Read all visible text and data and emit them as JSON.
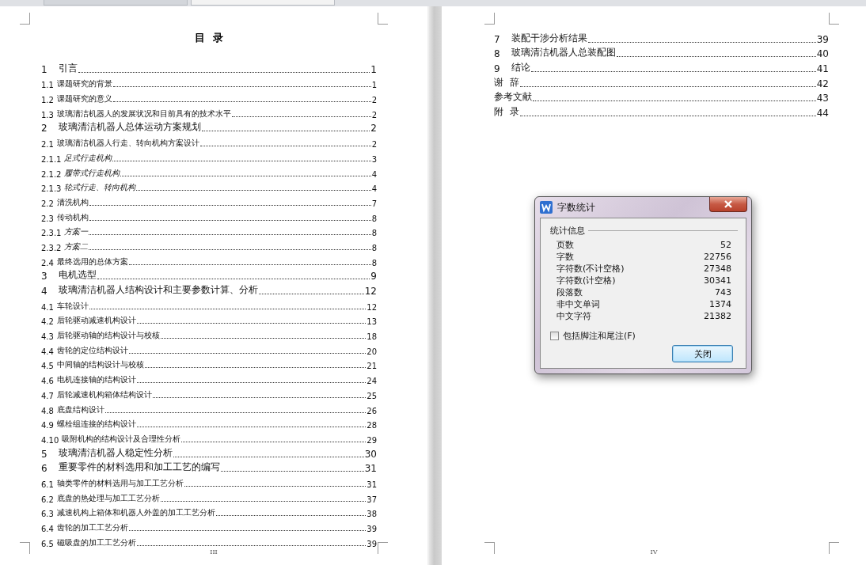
{
  "left_page": {
    "title": "目  录",
    "footer": "III",
    "entries": [
      {
        "kind": "chapter",
        "number": "1",
        "title": "引言",
        "page": "1"
      },
      {
        "kind": "section",
        "number": "1.1",
        "title": "课题研究的背景",
        "page": "1"
      },
      {
        "kind": "section",
        "number": "1.2",
        "title": "课题研究的意义",
        "page": "2"
      },
      {
        "kind": "section",
        "number": "1.3",
        "title": "玻璃清洁机器人的发展状况和目前具有的技术水平",
        "page": "2"
      },
      {
        "kind": "chapter",
        "number": "2",
        "title": "玻璃清洁机器人总体运动方案规划",
        "page": "2"
      },
      {
        "kind": "section",
        "number": "2.1",
        "title": "玻璃清洁机器人行走、转向机构方案设计",
        "page": "2"
      },
      {
        "kind": "subsection",
        "number": "2.1.1",
        "title": "足式行走机构",
        "page": "3"
      },
      {
        "kind": "subsection",
        "number": "2.1.2",
        "title": "履带式行走机构",
        "page": "4"
      },
      {
        "kind": "subsection",
        "number": "2.1.3",
        "title": "轮式行走、转向机构",
        "page": "4"
      },
      {
        "kind": "section",
        "number": "2.2",
        "title": "清洗机构",
        "page": "7"
      },
      {
        "kind": "section",
        "number": "2.3",
        "title": "传动机构",
        "page": "8"
      },
      {
        "kind": "subsection",
        "number": "2.3.1",
        "title": "方案一",
        "page": "8"
      },
      {
        "kind": "subsection",
        "number": "2.3.2",
        "title": "方案二",
        "page": "8"
      },
      {
        "kind": "section",
        "number": "2.4",
        "title": "最终选用的总体方案",
        "page": "8"
      },
      {
        "kind": "chapter",
        "number": "3",
        "title": "电机选型",
        "page": "9"
      },
      {
        "kind": "chapter",
        "number": "4",
        "title": "玻璃清洁机器人结构设计和主要参数计算、分析",
        "page": "12"
      },
      {
        "kind": "section",
        "number": "4.1",
        "title": "车轮设计",
        "page": "12"
      },
      {
        "kind": "section",
        "number": "4.2",
        "title": "后轮驱动减速机构设计",
        "page": "13"
      },
      {
        "kind": "section",
        "number": "4.3",
        "title": "后轮驱动轴的结构设计与校核",
        "page": "18"
      },
      {
        "kind": "section",
        "number": "4.4",
        "title": "齿轮的定位结构设计",
        "page": "20"
      },
      {
        "kind": "section",
        "number": "4.5",
        "title": "中间轴的结构设计与校核",
        "page": "21"
      },
      {
        "kind": "section",
        "number": "4.6",
        "title": "电机连接轴的结构设计",
        "page": "24"
      },
      {
        "kind": "section",
        "number": "4.7",
        "title": "后轮减速机构箱体结构设计",
        "page": "25"
      },
      {
        "kind": "section",
        "number": "4.8",
        "title": "底盘结构设计",
        "page": "26"
      },
      {
        "kind": "section",
        "number": "4.9",
        "title": "螺栓组连接的结构设计",
        "page": "28"
      },
      {
        "kind": "section",
        "number": "4.10",
        "title": "吸附机构的结构设计及合理性分析",
        "page": "29"
      },
      {
        "kind": "chapter",
        "number": "5",
        "title": "玻璃清洁机器人稳定性分析",
        "page": "30"
      },
      {
        "kind": "chapter",
        "number": "6",
        "title": "重要零件的材料选用和加工工艺的编写",
        "page": "31"
      },
      {
        "kind": "section",
        "number": "6.1",
        "title": "轴类零件的材料选用与加工工艺分析",
        "page": "31"
      },
      {
        "kind": "section",
        "number": "6.2",
        "title": "底盘的热处理与加工工艺分析",
        "page": "37"
      },
      {
        "kind": "section",
        "number": "6.3",
        "title": "减速机构上箱体和机器人外盖的加工工艺分析",
        "page": "38"
      },
      {
        "kind": "section",
        "number": "6.4",
        "title": "齿轮的加工工艺分析",
        "page": "39"
      },
      {
        "kind": "section",
        "number": "6.5",
        "title": "磁吸盘的加工工艺分析",
        "page": "39"
      }
    ]
  },
  "right_page": {
    "footer": "IV",
    "entries": [
      {
        "kind": "chapter",
        "number": "7",
        "title": "装配干涉分析结果",
        "page": "39"
      },
      {
        "kind": "chapter",
        "number": "8",
        "title": "玻璃清洁机器人总装配图",
        "page": "40"
      },
      {
        "kind": "chapter",
        "number": "9",
        "title": "结论",
        "page": "41"
      },
      {
        "kind": "back",
        "title": "谢  辞",
        "page": "42"
      },
      {
        "kind": "back",
        "title": "参考文献",
        "page": "43"
      },
      {
        "kind": "back",
        "title": "附  录",
        "page": "44"
      }
    ]
  },
  "dialog": {
    "title": "字数统计",
    "group": "统计信息",
    "stats": [
      {
        "label": "页数",
        "value": "52"
      },
      {
        "label": "字数",
        "value": "22756"
      },
      {
        "label": "字符数(不计空格)",
        "value": "27348"
      },
      {
        "label": "字符数(计空格)",
        "value": "30341"
      },
      {
        "label": "段落数",
        "value": "743"
      },
      {
        "label": "非中文单词",
        "value": "1374"
      },
      {
        "label": "中文字符",
        "value": "21382"
      }
    ],
    "checkbox": {
      "label": "包括脚注和尾注(F)",
      "checked": false
    },
    "button": "关闭"
  }
}
